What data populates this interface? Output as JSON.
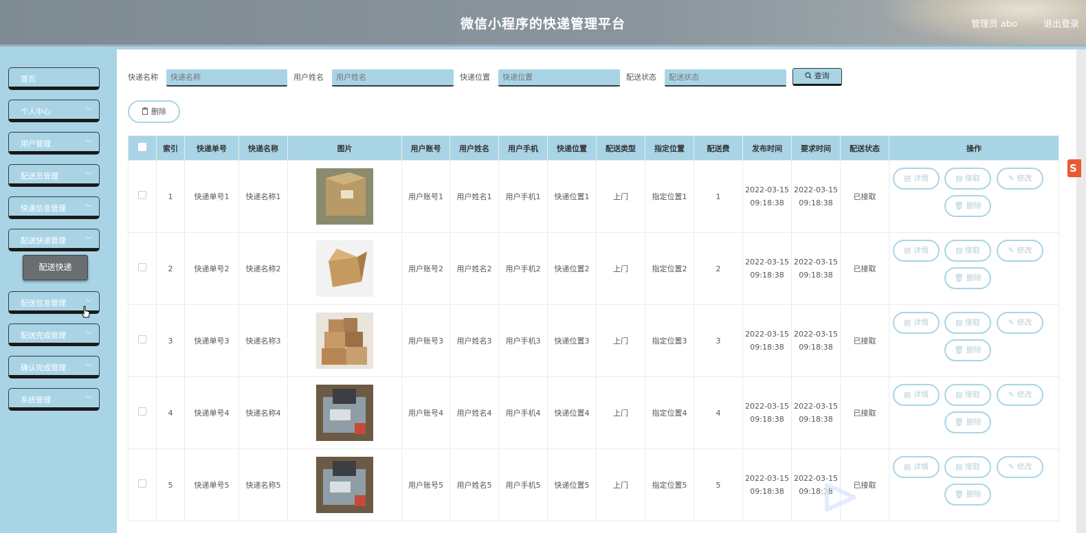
{
  "header": {
    "title": "微信小程序的快递管理平台",
    "admin": "管理员 abo",
    "logout": "退出登录"
  },
  "sidebar": {
    "items": [
      {
        "label": "首页",
        "has_chevron": false
      },
      {
        "label": "个人中心",
        "has_chevron": true
      },
      {
        "label": "用户管理",
        "has_chevron": true
      },
      {
        "label": "配送员管理",
        "has_chevron": true
      },
      {
        "label": "快递信息管理",
        "has_chevron": true
      },
      {
        "label": "配送快递管理",
        "has_chevron": true
      },
      {
        "label": "配送信息管理",
        "has_chevron": true
      },
      {
        "label": "配送完成管理",
        "has_chevron": true
      },
      {
        "label": "确认完成管理",
        "has_chevron": true
      },
      {
        "label": "系统管理",
        "has_chevron": true
      }
    ],
    "active_sub": "配送快递"
  },
  "search": {
    "fields": [
      {
        "label": "快递名称",
        "placeholder": "快递名称"
      },
      {
        "label": "用户姓名",
        "placeholder": "用户姓名"
      },
      {
        "label": "快递位置",
        "placeholder": "快递位置"
      },
      {
        "label": "配送状态",
        "placeholder": "配送状态"
      }
    ],
    "button": "查询"
  },
  "toolbar": {
    "delete": "删除"
  },
  "table": {
    "columns": [
      "索引",
      "快递单号",
      "快递名称",
      "图片",
      "用户账号",
      "用户姓名",
      "用户手机",
      "快递位置",
      "配送类型",
      "指定位置",
      "配送费",
      "发布时间",
      "要求时间",
      "配送状态",
      "操作"
    ],
    "rows": [
      {
        "index": "1",
        "no": "快递单号1",
        "name": "快递名称1",
        "image": "box-closed",
        "account": "用户账号1",
        "uname": "用户姓名1",
        "phone": "用户手机1",
        "location": "快递位置1",
        "type": "上门",
        "target": "指定位置1",
        "fee": "1",
        "publish_time": "2022-03-15 09:18:38",
        "required_time": "2022-03-15 09:18:38",
        "status": "已接取"
      },
      {
        "index": "2",
        "no": "快递单号2",
        "name": "快递名称2",
        "image": "box-open",
        "account": "用户账号2",
        "uname": "用户姓名2",
        "phone": "用户手机2",
        "location": "快递位置2",
        "type": "上门",
        "target": "指定位置2",
        "fee": "2",
        "publish_time": "2022-03-15 09:18:38",
        "required_time": "2022-03-15 09:18:38",
        "status": "已接取"
      },
      {
        "index": "3",
        "no": "快递单号3",
        "name": "快递名称3",
        "image": "box-stack",
        "account": "用户账号3",
        "uname": "用户姓名3",
        "phone": "用户手机3",
        "location": "快递位置3",
        "type": "上门",
        "target": "指定位置3",
        "fee": "3",
        "publish_time": "2022-03-15 09:18:38",
        "required_time": "2022-03-15 09:18:38",
        "status": "已接取"
      },
      {
        "index": "4",
        "no": "快递单号4",
        "name": "快递名称4",
        "image": "parcel-bag",
        "account": "用户账号4",
        "uname": "用户姓名4",
        "phone": "用户手机4",
        "location": "快递位置4",
        "type": "上门",
        "target": "指定位置4",
        "fee": "4",
        "publish_time": "2022-03-15 09:18:38",
        "required_time": "2022-03-15 09:18:38",
        "status": "已接取"
      },
      {
        "index": "5",
        "no": "快递单号5",
        "name": "快递名称5",
        "image": "parcel-bag",
        "account": "用户账号5",
        "uname": "用户姓名5",
        "phone": "用户手机5",
        "location": "快递位置5",
        "type": "上门",
        "target": "指定位置5",
        "fee": "5",
        "publish_time": "2022-03-15 09:18:38",
        "required_time": "2022-03-15 09:18:38",
        "status": "已接取"
      }
    ],
    "actions": {
      "detail": "详情",
      "accept": "接取",
      "edit": "修改",
      "delete": "删除"
    }
  },
  "colors": {
    "accent": "#a9d4e6",
    "header": "#8a959d",
    "dark": "#1a1a1a"
  }
}
